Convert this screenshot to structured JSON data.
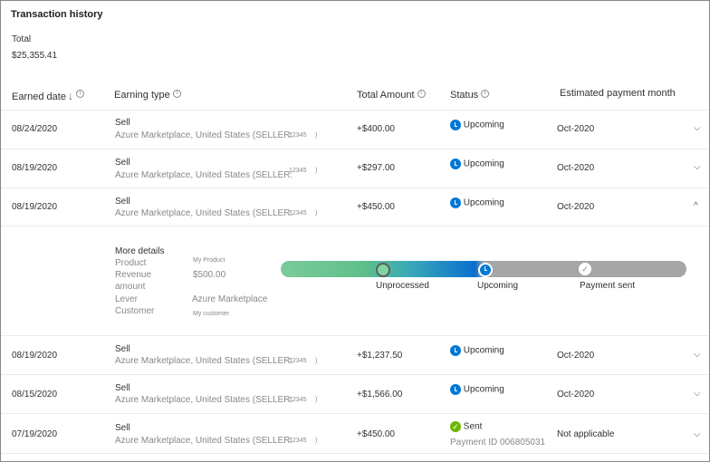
{
  "header": {
    "title": "Transaction history",
    "total_label": "Total",
    "total_value": "$25,355.41"
  },
  "columns": {
    "earned_date": "Earned date",
    "earning_type": "Earning type",
    "total_amount": "Total Amount",
    "status": "Status",
    "estimated_payment_month": "Estimated payment month"
  },
  "rows": [
    {
      "date": "08/24/2020",
      "type": "Sell",
      "detail": "Azure Marketplace, United States (SELLER:",
      "code": "12345",
      "code_suffix": ")",
      "amount": "+$400.00",
      "status": "Upcoming",
      "month": "Oct-2020",
      "chevron": "⌵"
    },
    {
      "date": "08/19/2020",
      "type": "Sell",
      "detail": "Azure Marketplace, United States (SELLER:",
      "code": "12345",
      "code_suffix": ")",
      "amount": "+$297.00",
      "status": "Upcoming",
      "month": "Oct-2020",
      "chevron": "⌵"
    },
    {
      "date": "08/19/2020",
      "type": "Sell",
      "detail": "Azure Marketplace, United States (SELLER:",
      "code": "12345",
      "code_suffix": ")",
      "amount": "+$450.00",
      "status": "Upcoming",
      "month": "Oct-2020",
      "chevron": "^"
    },
    {
      "date": "08/19/2020",
      "type": "Sell",
      "detail": "Azure Marketplace, United States (SELLER:",
      "code": "12345",
      "code_suffix": ")",
      "amount": "+$1,237.50",
      "status": "Upcoming",
      "month": "Oct-2020",
      "chevron": "⌵"
    },
    {
      "date": "08/15/2020",
      "type": "Sell",
      "detail": "Azure Marketplace, United States (SELLER:",
      "code": "12345",
      "code_suffix": ")",
      "amount": "+$1,566.00",
      "status": "Upcoming",
      "month": "Oct-2020",
      "chevron": "⌵"
    },
    {
      "date": "07/19/2020",
      "type": "Sell",
      "detail": "Azure Marketplace, United States (SELLER:",
      "code": "12345",
      "code_suffix": ")",
      "amount": "+$450.00",
      "status": "Sent",
      "payment_id": "Payment ID 006805031",
      "month": "Not applicable",
      "chevron": "⌵"
    }
  ],
  "details": {
    "heading": "More details",
    "product_label": "Product",
    "product_value": "My Product",
    "revenue_label_1": "Revenue",
    "revenue_label_2": "amount",
    "revenue_value": "$500.00",
    "lever_label": "Lever",
    "lever_value": "Azure Marketplace",
    "customer_label": "Customer",
    "customer_value": "My customer",
    "stages": [
      "Unprocessed",
      "Upcoming",
      "Payment sent"
    ]
  },
  "icons": {
    "info": "info-icon",
    "sort": "sort-down-icon",
    "upcoming": "clock-icon",
    "sent": "checkmark-icon"
  },
  "colors": {
    "upcoming": "#0078d4",
    "sent": "#6bb700",
    "progress_start": "#7bcb9a",
    "progress_end": "#a6a6a6"
  }
}
